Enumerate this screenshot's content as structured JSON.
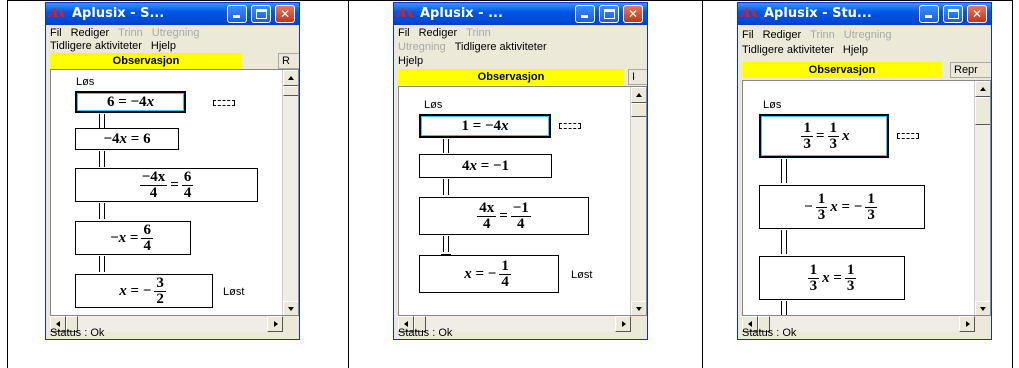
{
  "windows": [
    {
      "title": "Aplusix - S...",
      "logo": "Ax",
      "menu_rows": [
        [
          {
            "label": "Fil",
            "enabled": true
          },
          {
            "label": "Rediger",
            "enabled": true
          },
          {
            "label": "Trinn",
            "enabled": false
          },
          {
            "label": "Utregning",
            "enabled": false
          }
        ],
        [
          {
            "label": "Tidligere aktiviteter",
            "enabled": true
          },
          {
            "label": "Hjelp",
            "enabled": true
          }
        ]
      ],
      "active_tab": "Observasjon",
      "other_tab": "R",
      "solve_label": "Løs",
      "steps": [
        "6 = −4x",
        "−4x = 6",
        "−4x/4 = 6/4",
        "−x = 6/4",
        "x = −3/2"
      ],
      "solved_label": "Løst",
      "status": "Status : Ok"
    },
    {
      "title": "Aplusix - ...",
      "logo": "Ax",
      "menu_rows": [
        [
          {
            "label": "Fil",
            "enabled": true
          },
          {
            "label": "Rediger",
            "enabled": true
          },
          {
            "label": "Trinn",
            "enabled": false
          }
        ],
        [
          {
            "label": "Utregning",
            "enabled": false
          },
          {
            "label": "Tidligere aktiviteter",
            "enabled": true
          }
        ],
        [
          {
            "label": "Hjelp",
            "enabled": true
          }
        ]
      ],
      "active_tab": "Observasjon",
      "other_tab": "I",
      "solve_label": "Løs",
      "steps": [
        "1 = −4x",
        "4x = −1",
        "4x/4 = −1/4",
        "x = −1/4"
      ],
      "solved_label": "Løst",
      "status": "Status : Ok"
    },
    {
      "title": "Aplusix - Stu...",
      "logo": "Ax",
      "menu_rows": [
        [
          {
            "label": "Fil",
            "enabled": true
          },
          {
            "label": "Rediger",
            "enabled": true
          },
          {
            "label": "Trinn",
            "enabled": false
          },
          {
            "label": "Utregning",
            "enabled": false
          }
        ],
        [
          {
            "label": "Tidligere aktiviteter",
            "enabled": true
          },
          {
            "label": "Hjelp",
            "enabled": true
          }
        ]
      ],
      "active_tab": "Observasjon",
      "other_tab": "Repr",
      "solve_label": "Løs",
      "steps": [
        "1/3 = 1/3 x",
        "−1/3 x = −1/3",
        "1/3 x = 1/3"
      ],
      "solved_label": "",
      "status": "Status : Ok"
    }
  ],
  "math": {
    "w1": {
      "s1": {
        "a": "6",
        "eq": "=",
        "b": "−4",
        "v": "x"
      },
      "s2": {
        "a": "−4",
        "v": "x",
        "eq": "=",
        "b": "6"
      },
      "s3": {
        "n1": "−4x",
        "d1": "4",
        "eq": "=",
        "n2": "6",
        "d2": "4"
      },
      "s4": {
        "a": "−",
        "v": "x",
        "eq": "=",
        "n": "6",
        "d": "4"
      },
      "s5": {
        "v": "x",
        "eq": "=",
        "s": "−",
        "n": "3",
        "d": "2"
      }
    },
    "w2": {
      "s1": {
        "a": "1",
        "eq": "=",
        "b": "−4",
        "v": "x"
      },
      "s2": {
        "a": "4",
        "v": "x",
        "eq": "=",
        "b": "−1"
      },
      "s3": {
        "n1": "4x",
        "d1": "4",
        "eq": "=",
        "n2": "−1",
        "d2": "4"
      },
      "s4": {
        "v": "x",
        "eq": "=",
        "s": "−",
        "n": "1",
        "d": "4"
      }
    },
    "w3": {
      "s1": {
        "n1": "1",
        "d1": "3",
        "eq": "=",
        "n2": "1",
        "d2": "3",
        "v": "x"
      },
      "s2": {
        "s": "−",
        "n1": "1",
        "d1": "3",
        "v": "x",
        "eq": "= −",
        "n2": "1",
        "d2": "3"
      },
      "s3": {
        "n1": "1",
        "d1": "3",
        "v": "x",
        "eq": "=",
        "n2": "1",
        "d2": "3"
      }
    }
  },
  "colors": {
    "titlebar": "#0058e6",
    "tab_active": "#ffff00",
    "window_bg": "#ece9d8",
    "close": "#c1351a"
  }
}
